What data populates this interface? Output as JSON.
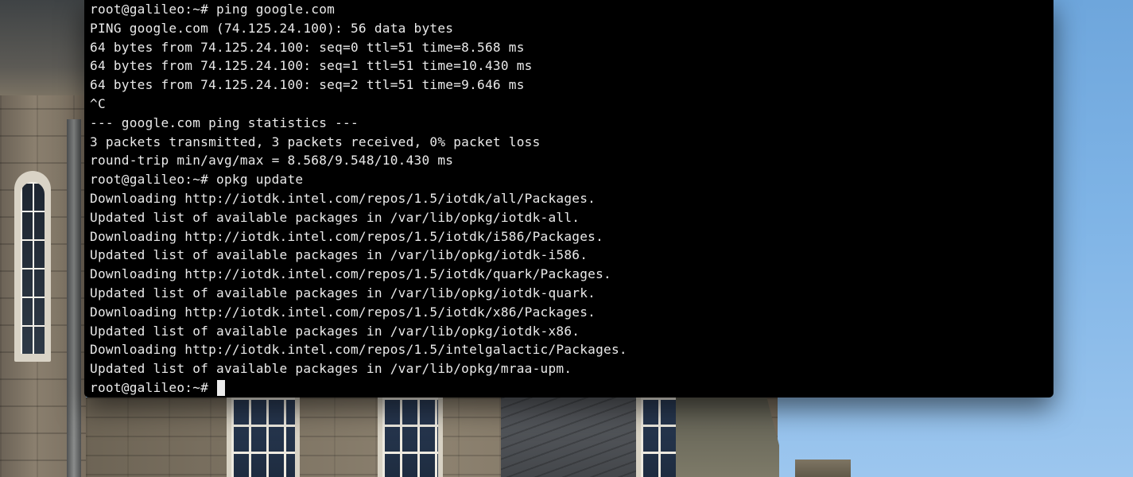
{
  "terminal": {
    "lines": [
      "root@galileo:~# ping google.com",
      "PING google.com (74.125.24.100): 56 data bytes",
      "64 bytes from 74.125.24.100: seq=0 ttl=51 time=8.568 ms",
      "64 bytes from 74.125.24.100: seq=1 ttl=51 time=10.430 ms",
      "64 bytes from 74.125.24.100: seq=2 ttl=51 time=9.646 ms",
      "^C",
      "--- google.com ping statistics ---",
      "3 packets transmitted, 3 packets received, 0% packet loss",
      "round-trip min/avg/max = 8.568/9.548/10.430 ms",
      "root@galileo:~# opkg update",
      "Downloading http://iotdk.intel.com/repos/1.5/iotdk/all/Packages.",
      "Updated list of available packages in /var/lib/opkg/iotdk-all.",
      "Downloading http://iotdk.intel.com/repos/1.5/iotdk/i586/Packages.",
      "Updated list of available packages in /var/lib/opkg/iotdk-i586.",
      "Downloading http://iotdk.intel.com/repos/1.5/iotdk/quark/Packages.",
      "Updated list of available packages in /var/lib/opkg/iotdk-quark.",
      "Downloading http://iotdk.intel.com/repos/1.5/iotdk/x86/Packages.",
      "Updated list of available packages in /var/lib/opkg/iotdk-x86.",
      "Downloading http://iotdk.intel.com/repos/1.5/intelgalactic/Packages.",
      "Updated list of available packages in /var/lib/opkg/mraa-upm."
    ],
    "prompt": "root@galileo:~# ",
    "colors": {
      "background": "#000000",
      "text": "#eaeaea",
      "cursor": "#ececec"
    }
  },
  "desktop": {
    "wallpaper": "stone-building-photo"
  }
}
